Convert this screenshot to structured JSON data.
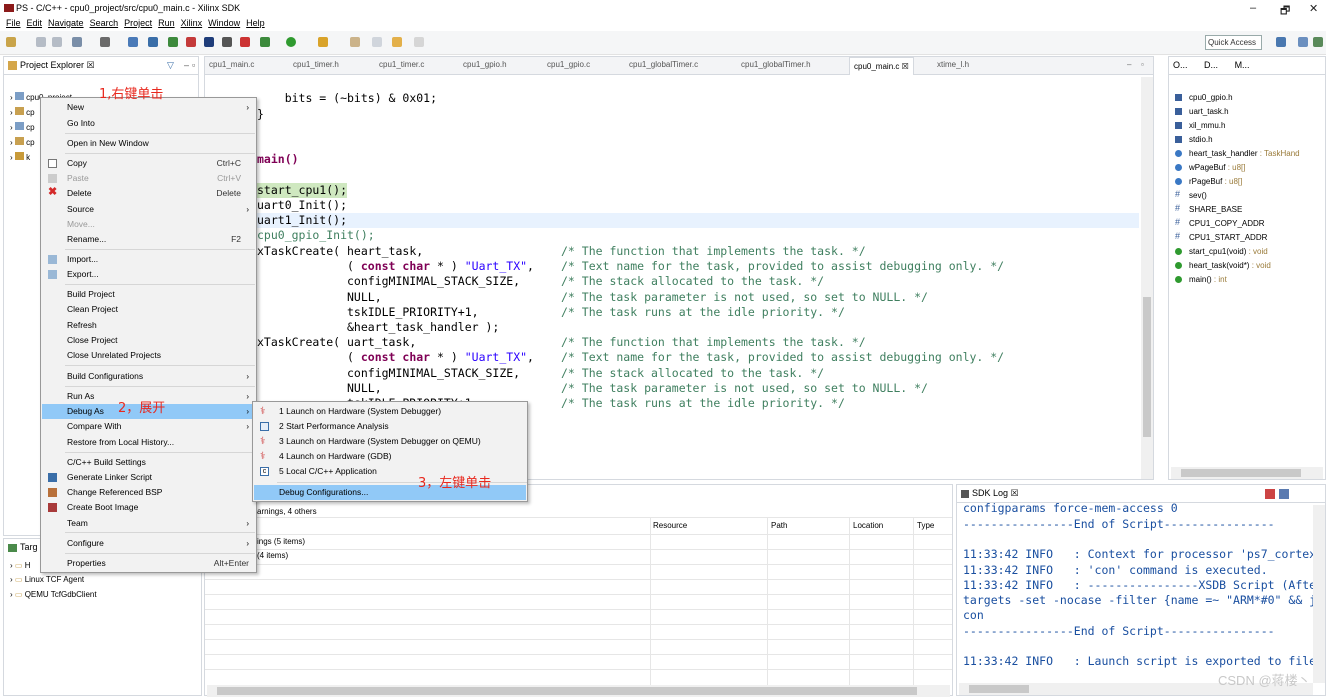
{
  "window": {
    "title": "PS - C/C++ - cpu0_project/src/cpu0_main.c - Xilinx SDK",
    "minimize": "–",
    "maximize": "🗗",
    "close": "✕"
  },
  "menubar": [
    "File",
    "Edit",
    "Navigate",
    "Search",
    "Project",
    "Run",
    "Xilinx",
    "Window",
    "Help"
  ],
  "toolbar": {
    "quick_access_placeholder": "Quick Access"
  },
  "project_explorer": {
    "tab_label": "Project Explorer ☒",
    "items": [
      "cpu0_project",
      "cp",
      "cp",
      "cp",
      "k"
    ]
  },
  "target_connections": {
    "tab_label": "Targ",
    "items": [
      "H",
      "Linux TCF Agent",
      "QEMU TcfGdbClient"
    ]
  },
  "editor_tabs": [
    "cpu1_main.c",
    "cpu1_timer.h",
    "cpu1_timer.c",
    "cpu1_gpio.h",
    "cpu1_gpio.c",
    "cpu1_globalTimer.c",
    "cpu1_globalTimer.h",
    "cpu0_main.c ☒",
    "xtime_l.h"
  ],
  "code": {
    "l1": "    bits = (~bits) & 0x01;",
    "l2": "}",
    "l3a": "",
    "l3": "main()",
    "l4": "start_cpu1();",
    "l5": "uart0_Init();",
    "l6": "uart1_Init();",
    "l7": "cpu0_gpio_Init();",
    "l8a": "xTaskCreate( heart_task,",
    "l8b": "/* The function that implements the task. */",
    "l9a": "( ",
    "l9kw": "const char",
    "l9b": " * ) ",
    "l9s": "\"Uart_TX\"",
    "l9c": ",",
    "l9d": "/* Text name for the task, provided to assist debugging only. */",
    "l10a": "configMINIMAL_STACK_SIZE,",
    "l10b": "/* The stack allocated to the task. */",
    "l11a": "NULL,",
    "l11b": "/* The task parameter is not used, so set to NULL. */",
    "l12a": "tskIDLE_PRIORITY+1,",
    "l12b": "/* The task runs at the idle priority. */",
    "l13a": "&heart_task_handler );",
    "l14a": "xTaskCreate( uart_task,",
    "l14b": "/* The function that implements the task. */",
    "l15d": "/* Text name for the task, provided to assist debugging only. */",
    "l16b": "/* The stack allocated to the task. */",
    "l17b": "/* The task parameter is not used, so set to NULL. */",
    "l18a": "tskIDLE_PRIORITY+1",
    "l18b": "/* The task runs at the idle priority. */"
  },
  "outline": {
    "tabs": [
      "O...",
      "D...",
      "M..."
    ],
    "items": [
      {
        "name": "cpu0_gpio.h",
        "type": ""
      },
      {
        "name": "uart_task.h",
        "type": ""
      },
      {
        "name": "xil_mmu.h",
        "type": ""
      },
      {
        "name": "stdio.h",
        "type": ""
      },
      {
        "name": "heart_task_handler",
        "type": " : TaskHand"
      },
      {
        "name": "wPageBuf",
        "type": " : u8[]"
      },
      {
        "name": "rPageBuf",
        "type": " : u8[]"
      },
      {
        "name": "sev()",
        "type": ""
      },
      {
        "name": "SHARE_BASE",
        "type": ""
      },
      {
        "name": "CPU1_COPY_ADDR",
        "type": ""
      },
      {
        "name": "CPU1_START_ADDR",
        "type": ""
      },
      {
        "name": "start_cpu1(void)",
        "type": " : void"
      },
      {
        "name": "heart_task(void*)",
        "type": " : void"
      },
      {
        "name": "main()",
        "type": " : int"
      }
    ]
  },
  "problems": {
    "summary": "arnings, 4 others",
    "columns": [
      "Resource",
      "Path",
      "Location",
      "Type"
    ],
    "rows": [
      "ings (5 items)",
      "(4 items)"
    ]
  },
  "sdk_log": {
    "tab_label": "SDK Log ☒",
    "lines": [
      "configparams force-mem-access 0",
      "----------------End of Script----------------",
      "",
      "11:33:42 INFO   : Context for processor 'ps7_cortex",
      "11:33:42 INFO   : 'con' command is executed.",
      "11:33:42 INFO   : ----------------XSDB Script (Afte",
      "targets -set -nocase -filter {name =~ \"ARM*#0\" && j",
      "con",
      "----------------End of Script----------------",
      "",
      "11:33:42 INFO   : Launch script is exported to file"
    ]
  },
  "context_menu": {
    "new": "New",
    "go_into": "Go Into",
    "open_new_window": "Open in New Window",
    "copy": "Copy",
    "copy_sc": "Ctrl+C",
    "paste": "Paste",
    "paste_sc": "Ctrl+V",
    "delete": "Delete",
    "delete_sc": "Delete",
    "source": "Source",
    "move": "Move...",
    "rename": "Rename...",
    "rename_sc": "F2",
    "import": "Import...",
    "export": "Export...",
    "build_project": "Build Project",
    "clean_project": "Clean Project",
    "refresh": "Refresh",
    "close_project": "Close Project",
    "close_unrelated": "Close Unrelated Projects",
    "build_configurations": "Build Configurations",
    "run_as": "Run As",
    "debug_as": "Debug As",
    "compare_with": "Compare With",
    "restore_history": "Restore from Local History...",
    "cpp_build_settings": "C/C++ Build Settings",
    "generate_linker": "Generate Linker Script",
    "change_bsp": "Change Referenced BSP",
    "create_boot_image": "Create Boot Image",
    "team": "Team",
    "configure": "Configure",
    "properties": "Properties",
    "properties_sc": "Alt+Enter"
  },
  "debug_submenu": {
    "item1": "1 Launch on Hardware (System Debugger)",
    "item2": "2 Start Performance Analysis",
    "item3": "3 Launch on Hardware (System Debugger on QEMU)",
    "item4": "4 Launch on Hardware (GDB)",
    "item5": "5 Local C/C++ Application",
    "debug_configs": "Debug Configurations..."
  },
  "annotations": {
    "step1": "1,右键单击",
    "step2": "2，展开",
    "step3": "3，左键单击"
  },
  "watermark": "CSDN @蒋楼丶",
  "colors": {
    "annotation": "#e8281e",
    "selection": "#91c9f7",
    "comment": "#3f7f5f",
    "keyword": "#7f0055",
    "string": "#2a00ff",
    "log_text": "#1a4fa0"
  }
}
